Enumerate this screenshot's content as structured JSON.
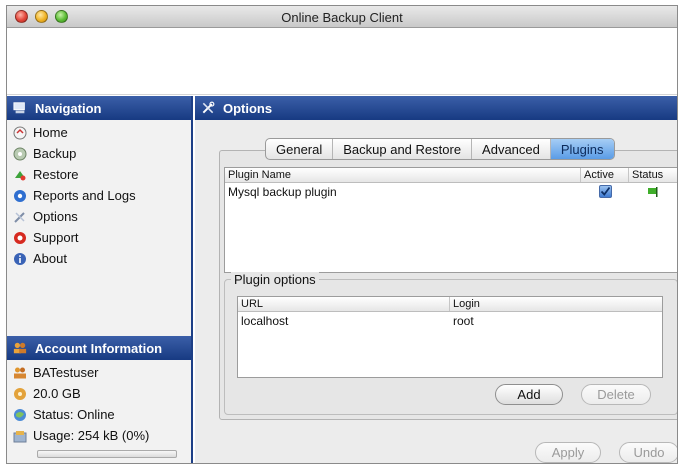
{
  "window": {
    "title": "Online Backup Client"
  },
  "navigation": {
    "header": "Navigation",
    "items": [
      {
        "label": "Home",
        "icon": "home-icon"
      },
      {
        "label": "Backup",
        "icon": "backup-icon"
      },
      {
        "label": "Restore",
        "icon": "restore-icon"
      },
      {
        "label": "Reports and Logs",
        "icon": "reports-icon"
      },
      {
        "label": "Options",
        "icon": "options-icon"
      },
      {
        "label": "Support",
        "icon": "support-icon"
      },
      {
        "label": "About",
        "icon": "info-icon"
      }
    ]
  },
  "account": {
    "header": "Account Information",
    "user": "BATestuser",
    "quota": "20.0 GB",
    "status": "Status: Online",
    "usage": "Usage: 254 kB (0%)",
    "usage_fraction": 0.0
  },
  "options": {
    "header": "Options",
    "tabs": [
      "General",
      "Backup and Restore",
      "Advanced",
      "Plugins"
    ],
    "active_tab": "Plugins"
  },
  "plugins_table": {
    "columns": [
      "Plugin Name",
      "Active",
      "Status"
    ],
    "rows": [
      {
        "name": "Mysql backup plugin",
        "active": true,
        "status": "green"
      }
    ]
  },
  "plugin_options": {
    "title": "Plugin options",
    "columns": [
      "URL",
      "Login"
    ],
    "rows": [
      {
        "url": "localhost",
        "login": "root"
      }
    ],
    "add_label": "Add",
    "delete_label": "Delete"
  },
  "footer": {
    "apply_label": "Apply",
    "undo_label": "Undo"
  },
  "colors": {
    "header_blue": "#1d3f86",
    "tab_active": "#5a9ce6",
    "status_green": "#3fae2a"
  }
}
